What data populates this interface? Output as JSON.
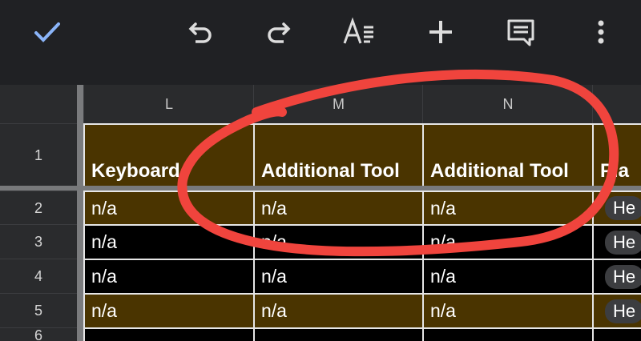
{
  "toolbar": {
    "icons": [
      "check-icon",
      "undo-icon",
      "redo-icon",
      "text-format-icon",
      "add-icon",
      "comment-icon",
      "more-vert-icon"
    ],
    "accent": "#8ab4f8"
  },
  "grid": {
    "columns": [
      "L",
      "M",
      "N"
    ],
    "rows": [
      "1",
      "2",
      "3",
      "4",
      "5",
      "6"
    ],
    "headers": [
      "Keyboard",
      "Additional Tool",
      "Additional Tool",
      "Pla"
    ],
    "cells": {
      "r2": [
        "n/a",
        "n/a",
        "n/a",
        "He"
      ],
      "r3": [
        "n/a",
        "n/a",
        "n/a",
        "He"
      ],
      "r4": [
        "n/a",
        "n/a",
        "n/a",
        "He"
      ],
      "r5": [
        "n/a",
        "n/a",
        "n/a",
        "He"
      ]
    },
    "row_colors": {
      "brown": "#4a3400",
      "black": "#000000"
    },
    "annotation_color": "#f0443d"
  }
}
